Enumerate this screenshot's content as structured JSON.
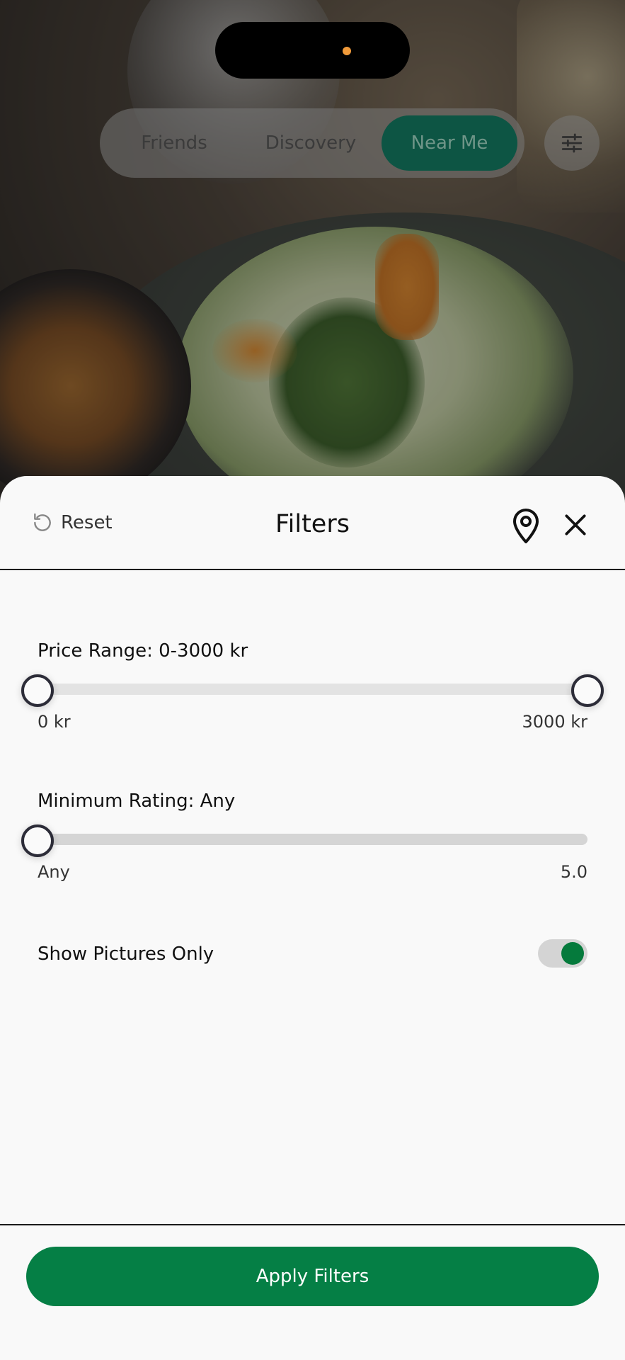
{
  "colors": {
    "accent_green": "#057f45",
    "active_tab": "#0d5544",
    "toggle_on": "#057a3c",
    "camera_dot": "#f09a3a"
  },
  "top_tabs": [
    {
      "label": "Friends",
      "active": false
    },
    {
      "label": "Discovery",
      "active": false
    },
    {
      "label": "Near Me",
      "active": true
    }
  ],
  "top_filter_icon": "sliders-icon",
  "filters_sheet": {
    "reset_label": "Reset",
    "reset_icon": "reset-icon",
    "title": "Filters",
    "location_icon": "map-pin-icon",
    "close_icon": "close-icon",
    "price": {
      "label": "Price Range: 0-3000 kr",
      "min_label": "0 kr",
      "max_label": "3000 kr",
      "range": [
        0,
        3000
      ],
      "selected": [
        0,
        3000
      ]
    },
    "rating": {
      "label": "Minimum Rating: Any",
      "min_label": "Any",
      "max_label": "5.0",
      "range": [
        0,
        5
      ],
      "selected": 0
    },
    "pictures_only": {
      "label": "Show Pictures Only",
      "enabled": true
    },
    "apply_label": "Apply Filters"
  }
}
